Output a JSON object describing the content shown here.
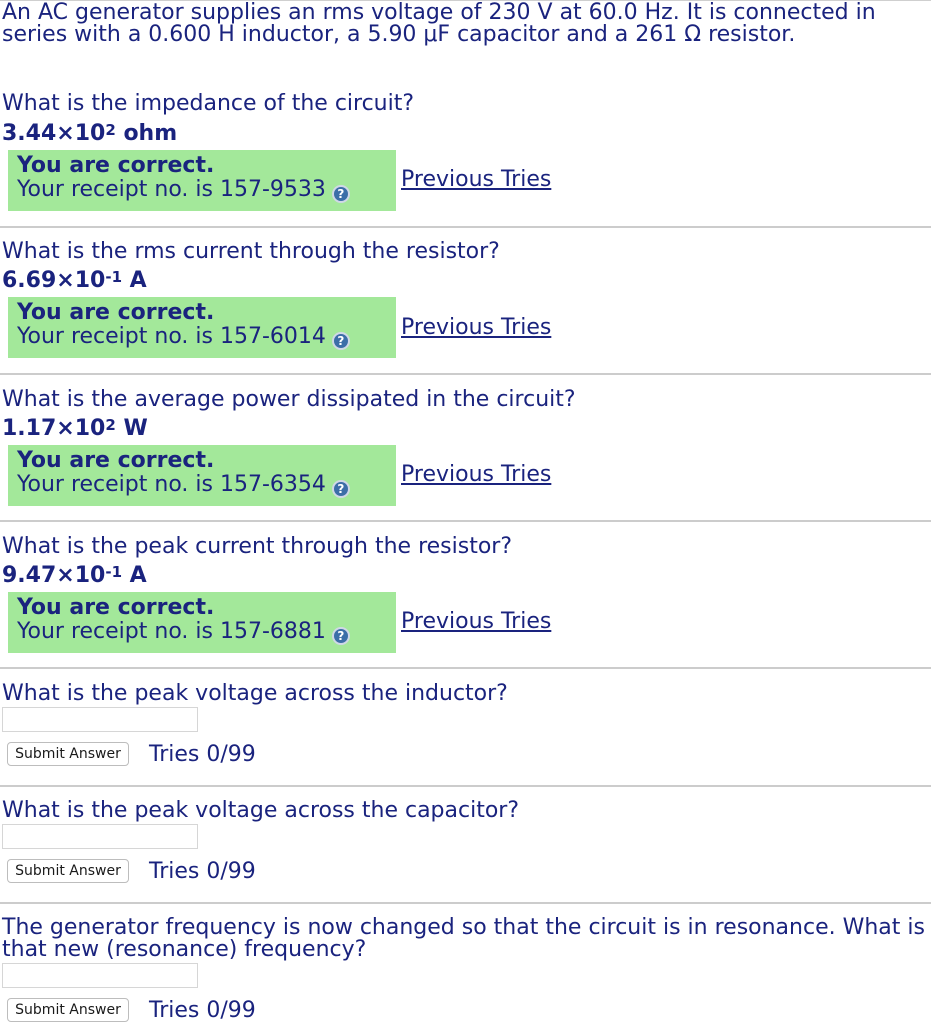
{
  "problem": {
    "intro": "An AC generator supplies an rms voltage of 230 V at 60.0 Hz. It is connected in series with a 0.600 H inductor, a 5.90 μF capacitor and a 261 Ω resistor."
  },
  "parts": [
    {
      "question": "What is the impedance of the circuit?",
      "answer_mantissa": "3.44×10",
      "answer_exponent": "2",
      "answer_unit": " ohm",
      "status_title": "You are correct.",
      "receipt_text": "Your receipt no. is 157-9533",
      "previous_tries_label": "Previous Tries"
    },
    {
      "question": "What is the rms current through the resistor?",
      "answer_mantissa": "6.69×10",
      "answer_exponent": "-1",
      "answer_unit": " A",
      "status_title": "You are correct.",
      "receipt_text": "Your receipt no. is 157-6014",
      "previous_tries_label": "Previous Tries"
    },
    {
      "question": "What is the average power dissipated in the circuit?",
      "answer_mantissa": "1.17×10",
      "answer_exponent": "2",
      "answer_unit": " W",
      "status_title": "You are correct.",
      "receipt_text": "Your receipt no. is 157-6354",
      "previous_tries_label": "Previous Tries"
    },
    {
      "question": "What is the peak current through the resistor?",
      "answer_mantissa": "9.47×10",
      "answer_exponent": "-1",
      "answer_unit": " A",
      "status_title": "You are correct.",
      "receipt_text": "Your receipt no. is 157-6881",
      "previous_tries_label": "Previous Tries"
    },
    {
      "question": "What is the peak voltage across the inductor?",
      "input_value": "",
      "submit_label": "Submit Answer",
      "tries": "Tries 0/99"
    },
    {
      "question": "What is the peak voltage across the capacitor?",
      "input_value": "",
      "submit_label": "Submit Answer",
      "tries": "Tries 0/99"
    },
    {
      "question": "The generator frequency is now changed so that the circuit is in resonance. What is that new (resonance) frequency?",
      "input_value": "",
      "submit_label": "Submit Answer",
      "tries": "Tries 0/99"
    }
  ],
  "colors": {
    "text": "#1a237e",
    "correct_background": "#a3e89a",
    "help_icon": "#3c6ea8",
    "divider": "#cccccc"
  },
  "icons": {
    "help": "question-circle-icon"
  }
}
